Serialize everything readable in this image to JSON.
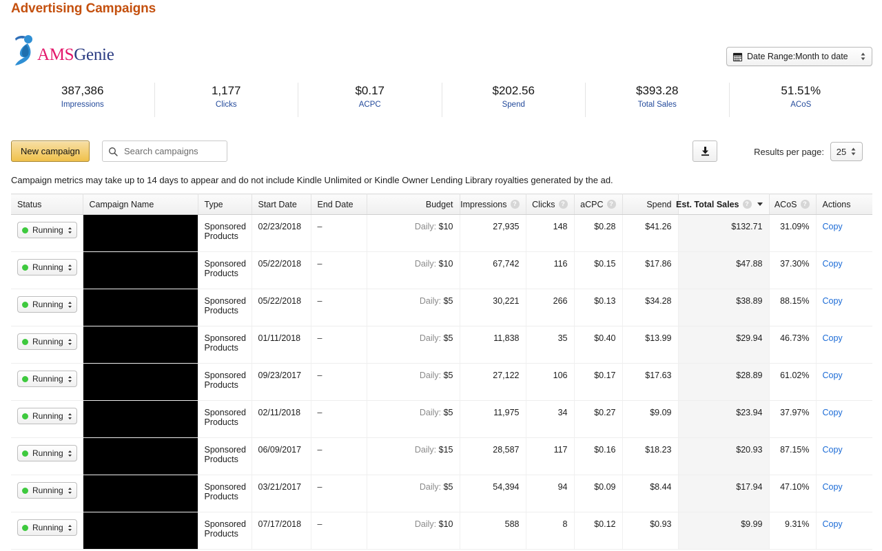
{
  "page": {
    "title": "Advertising Campaigns"
  },
  "brand": {
    "ams": "AMS",
    "genie": "Genie",
    "icon": "genie-figure-icon"
  },
  "date_range": {
    "label": "Date Range:Month to date",
    "icon": "calendar-icon"
  },
  "metrics": [
    {
      "value": "387,386",
      "label": "Impressions"
    },
    {
      "value": "1,177",
      "label": "Clicks"
    },
    {
      "value": "$0.17",
      "label": "ACPC"
    },
    {
      "value": "$202.56",
      "label": "Spend"
    },
    {
      "value": "$393.28",
      "label": "Total Sales"
    },
    {
      "value": "51.51%",
      "label": "ACoS"
    }
  ],
  "toolbar": {
    "new_campaign_label": "New campaign",
    "search_placeholder": "Search campaigns",
    "search_value": "",
    "download_icon": "download-icon",
    "results_per_page_label": "Results per page:",
    "results_per_page_value": "25"
  },
  "notice": "Campaign metrics may take up to 14 days to appear and do not include Kindle Unlimited or Kindle Owner Lending Library royalties generated by the ad.",
  "table": {
    "columns": [
      {
        "key": "status",
        "label": "Status",
        "align": "left",
        "info": false
      },
      {
        "key": "campaign_name",
        "label": "Campaign Name",
        "align": "left",
        "info": false
      },
      {
        "key": "type",
        "label": "Type",
        "align": "left",
        "info": false
      },
      {
        "key": "start_date",
        "label": "Start Date",
        "align": "left",
        "info": false
      },
      {
        "key": "end_date",
        "label": "End Date",
        "align": "left",
        "info": false
      },
      {
        "key": "budget",
        "label": "Budget",
        "align": "right",
        "info": false
      },
      {
        "key": "impressions",
        "label": "Impressions",
        "align": "right",
        "info": true
      },
      {
        "key": "clicks",
        "label": "Clicks",
        "align": "right",
        "info": true
      },
      {
        "key": "acpc",
        "label": "aCPC",
        "align": "right",
        "info": true
      },
      {
        "key": "spend",
        "label": "Spend",
        "align": "right",
        "info": false
      },
      {
        "key": "est_total_sales",
        "label": "Est. Total Sales",
        "align": "right",
        "info": true,
        "sorted": "desc"
      },
      {
        "key": "acos",
        "label": "ACoS",
        "align": "right",
        "info": true
      },
      {
        "key": "actions",
        "label": "Actions",
        "align": "left",
        "info": false
      }
    ],
    "budget_prefix": "Daily:",
    "action_label": "Copy",
    "status_label": "Running",
    "campaign_name_redacted": true,
    "rows": [
      {
        "status": "Running",
        "campaign_name": "",
        "type": "Sponsored Products",
        "start_date": "02/23/2018",
        "end_date": "–",
        "budget": "$10",
        "impressions": "27,935",
        "clicks": "148",
        "acpc": "$0.28",
        "spend": "$41.26",
        "est_total_sales": "$132.71",
        "acos": "31.09%",
        "actions": "Copy"
      },
      {
        "status": "Running",
        "campaign_name": "",
        "type": "Sponsored Products",
        "start_date": "05/22/2018",
        "end_date": "–",
        "budget": "$10",
        "impressions": "67,742",
        "clicks": "116",
        "acpc": "$0.15",
        "spend": "$17.86",
        "est_total_sales": "$47.88",
        "acos": "37.30%",
        "actions": "Copy"
      },
      {
        "status": "Running",
        "campaign_name": "",
        "type": "Sponsored Products",
        "start_date": "05/22/2018",
        "end_date": "–",
        "budget": "$5",
        "impressions": "30,221",
        "clicks": "266",
        "acpc": "$0.13",
        "spend": "$34.28",
        "est_total_sales": "$38.89",
        "acos": "88.15%",
        "actions": "Copy"
      },
      {
        "status": "Running",
        "campaign_name": "",
        "type": "Sponsored Products",
        "start_date": "01/11/2018",
        "end_date": "–",
        "budget": "$5",
        "impressions": "11,838",
        "clicks": "35",
        "acpc": "$0.40",
        "spend": "$13.99",
        "est_total_sales": "$29.94",
        "acos": "46.73%",
        "actions": "Copy"
      },
      {
        "status": "Running",
        "campaign_name": "",
        "type": "Sponsored Products",
        "start_date": "09/23/2017",
        "end_date": "–",
        "budget": "$5",
        "impressions": "27,122",
        "clicks": "106",
        "acpc": "$0.17",
        "spend": "$17.63",
        "est_total_sales": "$28.89",
        "acos": "61.02%",
        "actions": "Copy"
      },
      {
        "status": "Running",
        "campaign_name": "",
        "type": "Sponsored Products",
        "start_date": "02/11/2018",
        "end_date": "–",
        "budget": "$5",
        "impressions": "11,975",
        "clicks": "34",
        "acpc": "$0.27",
        "spend": "$9.09",
        "est_total_sales": "$23.94",
        "acos": "37.97%",
        "actions": "Copy"
      },
      {
        "status": "Running",
        "campaign_name": "",
        "type": "Sponsored Products",
        "start_date": "06/09/2017",
        "end_date": "–",
        "budget": "$15",
        "impressions": "28,587",
        "clicks": "117",
        "acpc": "$0.16",
        "spend": "$18.23",
        "est_total_sales": "$20.93",
        "acos": "87.15%",
        "actions": "Copy"
      },
      {
        "status": "Running",
        "campaign_name": "",
        "type": "Sponsored Products",
        "start_date": "03/21/2017",
        "end_date": "–",
        "budget": "$5",
        "impressions": "54,394",
        "clicks": "94",
        "acpc": "$0.09",
        "spend": "$8.44",
        "est_total_sales": "$17.94",
        "acos": "47.10%",
        "actions": "Copy"
      },
      {
        "status": "Running",
        "campaign_name": "",
        "type": "Sponsored Products",
        "start_date": "07/17/2018",
        "end_date": "–",
        "budget": "$10",
        "impressions": "588",
        "clicks": "8",
        "acpc": "$0.12",
        "spend": "$0.93",
        "est_total_sales": "$9.99",
        "acos": "9.31%",
        "actions": "Copy"
      }
    ]
  },
  "colors": {
    "title": "#c4500e",
    "link": "#1b6bd6",
    "metric_label": "#234a9b",
    "status_dot": "#3ec93e",
    "primary_button": "#f0c14b"
  }
}
